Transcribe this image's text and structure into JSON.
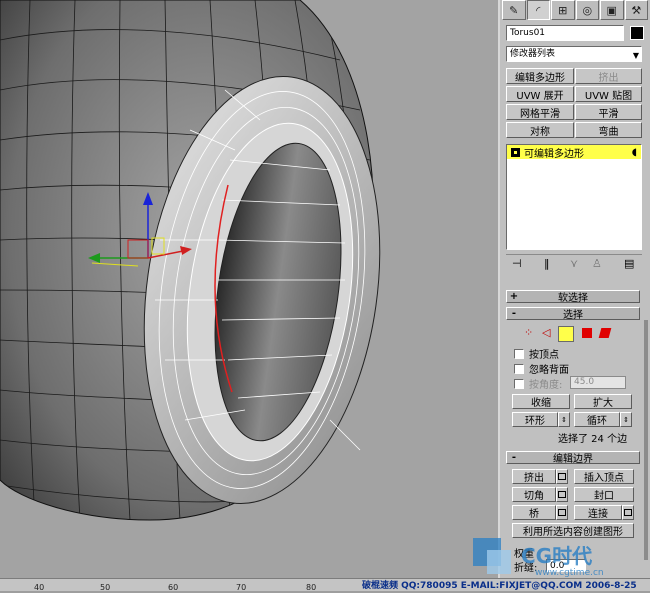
{
  "panel": {
    "tab_icons": [
      "create-icon",
      "modify-icon",
      "hierarchy-icon",
      "motion-icon",
      "display-icon",
      "utilities-icon"
    ],
    "object_name": "Torus01",
    "object_color": "#000000",
    "modifier_list": "修改器列表",
    "modifier_buttons": [
      {
        "label": "编辑多边形",
        "enabled": true
      },
      {
        "label": "挤出",
        "enabled": false
      },
      {
        "label": "UVW 展开",
        "enabled": true
      },
      {
        "label": "UVW 贴图",
        "enabled": true
      },
      {
        "label": "网格平滑",
        "enabled": true
      },
      {
        "label": "平滑",
        "enabled": true
      },
      {
        "label": "对称",
        "enabled": true
      },
      {
        "label": "弯曲",
        "enabled": true
      }
    ],
    "stack_item": "可编辑多边形",
    "stack_toolbar": [
      "pin-stack-icon",
      "show-end-result-icon",
      "make-unique-icon",
      "remove-modifier-icon",
      "configure-modifier-sets-icon"
    ],
    "soft_selection": {
      "symbol": "+",
      "label": "软选择"
    },
    "selection": {
      "symbol": "-",
      "label": "选择",
      "by_vertex": "按顶点",
      "ignore_backfacing": "忽略背面",
      "by_angle": "按角度:",
      "angle_value": "45.0",
      "shrink": "收缩",
      "grow": "扩大",
      "ring": "环形",
      "loop": "循环",
      "status": "选择了 24 个边"
    },
    "edit_edges": {
      "symbol": "-",
      "label": "编辑边界",
      "extrude": "挤出",
      "insert_vertex": "插入顶点",
      "chamfer": "切角",
      "cap": "封口",
      "bridge": "桥",
      "connect": "连接",
      "create_shape": "利用所选内容创建图形",
      "weight": "权重",
      "crease": "折缝:",
      "crease_value": "0.0"
    }
  },
  "ruler": {
    "ticks": [
      "40",
      "50",
      "60",
      "70",
      "80"
    ]
  },
  "status": {
    "text": "破棍速频 QQ:780095 E-MAIL:FIXJET@QQ.COM 2006-8-25"
  },
  "watermark": {
    "text": "CG时代",
    "url": "www.cgtime.cn"
  },
  "colors": {
    "selection_yellow": "#ffff4a",
    "panel_gray": "#c0c0c0",
    "viewport_gray": "#a3a3a3",
    "selected_edge": "#e02020",
    "status_blue": "#0a2f8a"
  }
}
